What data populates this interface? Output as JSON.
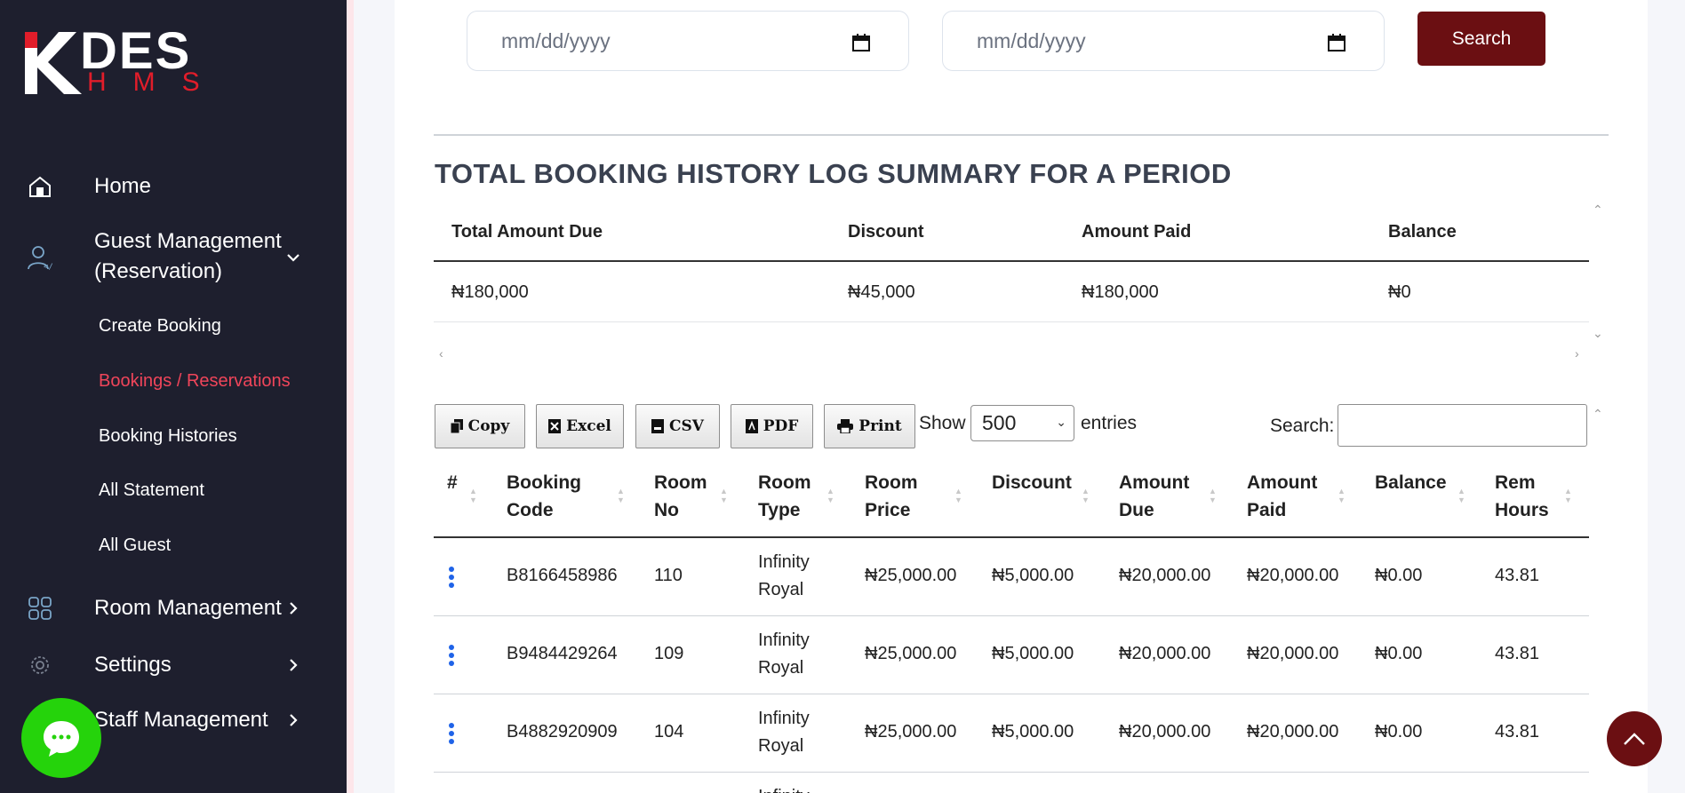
{
  "brand": {
    "logo_main": "DES",
    "logo_sub": "HMS"
  },
  "sidebar": {
    "items": [
      {
        "label": "Home",
        "icon": "home-icon"
      },
      {
        "label": "Guest Management",
        "label2": "(Reservation)",
        "icon": "user-code-icon"
      },
      {
        "label": "Room Management",
        "icon": "grid-icon"
      },
      {
        "label": "Settings",
        "icon": "gear-icon"
      },
      {
        "label": "Staff Management",
        "icon": "staff-icon"
      }
    ],
    "subitems": [
      {
        "label": "Create Booking"
      },
      {
        "label": "Bookings / Reservations",
        "active": true
      },
      {
        "label": "Booking Histories"
      },
      {
        "label": "All Statement"
      },
      {
        "label": "All Guest"
      }
    ]
  },
  "filters": {
    "start_date_placeholder": "mm/dd/yyyy",
    "end_date_placeholder": "mm/dd/yyyy",
    "search_label": "Search"
  },
  "summary": {
    "title": "TOTAL BOOKING HISTORY LOG SUMMARY FOR A PERIOD",
    "headers": [
      "Total Amount Due",
      "Discount",
      "Amount Paid",
      "Balance"
    ],
    "values": [
      "₦180,000",
      "₦45,000",
      "₦180,000",
      "₦0"
    ]
  },
  "toolbar": {
    "copy": "Copy",
    "excel": "Excel",
    "csv": "CSV",
    "pdf": "PDF",
    "print": "Print",
    "show_label": "Show",
    "entries_value": "500",
    "entries_label": "entries",
    "search_label": "Search:"
  },
  "table": {
    "headers": [
      {
        "l1": "#",
        "l2": ""
      },
      {
        "l1": "Booking",
        "l2": "Code"
      },
      {
        "l1": "Room",
        "l2": "No"
      },
      {
        "l1": "Room",
        "l2": "Type"
      },
      {
        "l1": "Room",
        "l2": "Price"
      },
      {
        "l1": "Discount",
        "l2": ""
      },
      {
        "l1": "Amount",
        "l2": "Due"
      },
      {
        "l1": "Amount",
        "l2": "Paid"
      },
      {
        "l1": "Balance",
        "l2": ""
      },
      {
        "l1": "Rem",
        "l2": "Hours"
      }
    ],
    "rows": [
      {
        "code": "B8166458986",
        "room_no": "110",
        "type1": "Infinity",
        "type2": "Royal",
        "price": "₦25,000.00",
        "discount": "₦5,000.00",
        "due": "₦20,000.00",
        "paid": "₦20,000.00",
        "balance": "₦0.00",
        "hours": "43.81"
      },
      {
        "code": "B9484429264",
        "room_no": "109",
        "type1": "Infinity",
        "type2": "Royal",
        "price": "₦25,000.00",
        "discount": "₦5,000.00",
        "due": "₦20,000.00",
        "paid": "₦20,000.00",
        "balance": "₦0.00",
        "hours": "43.81"
      },
      {
        "code": "B4882920909",
        "room_no": "104",
        "type1": "Infinity",
        "type2": "Royal",
        "price": "₦25,000.00",
        "discount": "₦5,000.00",
        "due": "₦20,000.00",
        "paid": "₦20,000.00",
        "balance": "₦0.00",
        "hours": "43.81"
      },
      {
        "type1": "Infinity"
      }
    ]
  },
  "colors": {
    "sidebar": "#1e1f2e",
    "brand_red": "#e11d2a",
    "primary": "#6b0f12",
    "active_link": "#f0455a",
    "chat": "#25d30b"
  }
}
